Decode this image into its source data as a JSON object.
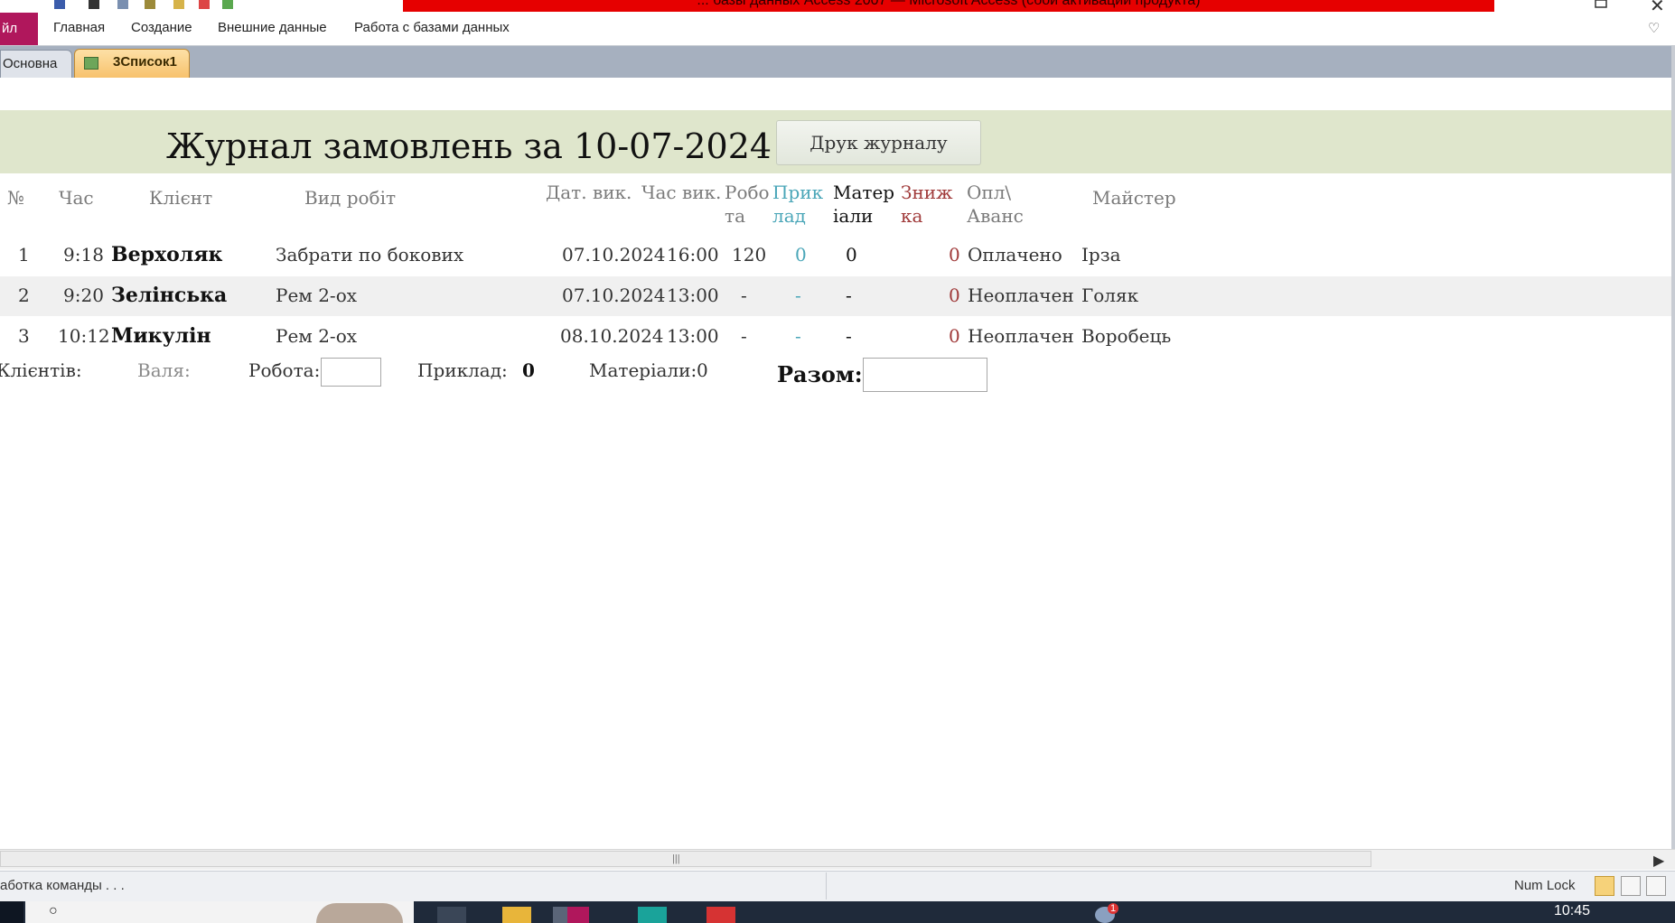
{
  "window": {
    "title": "... базы данных Access 2007 — Microsoft Access (сбой активации продукта)"
  },
  "ribbon": {
    "file_tab": "йл",
    "tabs": [
      "Главная",
      "Создание",
      "Внешние данные",
      "Работа с базами данных"
    ]
  },
  "doc_tabs": [
    "Основна",
    "3Список1"
  ],
  "form": {
    "title": "Журнал замовлень за  10-07-2024",
    "print_button": "Друк журналу",
    "headers": {
      "num": "№",
      "time": "Час",
      "client": "Клієнт",
      "work_type": "Вид робіт",
      "due_date": "Дат. вик.",
      "due_time": "Час вик.",
      "work_a": "Робо",
      "work_b": "та",
      "tool_a": "Прик",
      "tool_b": "лад",
      "mat_a": "Матер",
      "mat_b": "іали",
      "disc_a": "Зниж",
      "disc_b": "ка",
      "pay_a": "Опл\\",
      "pay_b": "Аванс",
      "master": "Майстер"
    },
    "rows": [
      {
        "num": "1",
        "time": "9:18",
        "client": "Верхоляк",
        "work": "Забрати по бокових",
        "date": "07.10.2024",
        "due": "16:00",
        "labor": "120",
        "tool": "0",
        "materials": "0",
        "discount": "0",
        "payment": "Оплачено",
        "master": "Ірза"
      },
      {
        "num": "2",
        "time": "9:20",
        "client": "Зелінська",
        "work": "Рем 2-ох",
        "date": "07.10.2024",
        "due": "13:00",
        "labor": "-",
        "tool": "-",
        "materials": "-",
        "discount": "0",
        "payment": "Неоплачен",
        "master": "Голяк"
      },
      {
        "num": "3",
        "time": "10:12",
        "client": "Микулін",
        "work": "Рем 2-ох",
        "date": "08.10.2024",
        "due": "13:00",
        "labor": "-",
        "tool": "-",
        "materials": "-",
        "discount": "0",
        "payment": "Неоплачен",
        "master": "Воробець"
      }
    ],
    "footer": {
      "clients_label": "Клієнтів:",
      "valya_label": "Валя:",
      "work_label": "Робота:",
      "tool_label": "Приклад:",
      "tool_value": "0",
      "materials_label": "Матеріали:",
      "materials_value": "0",
      "total_label": "Разом:"
    }
  },
  "status": {
    "text": "аботка команды . . .",
    "numlock": "Num Lock"
  },
  "taskbar": {
    "clock": "10:45",
    "badge": "1"
  },
  "colors": {
    "file_tab": "#b0175c",
    "title_bar": "#e60000",
    "header_band": "#dfe6cc",
    "tool_teal": "#4aa6b8",
    "discount_red": "#a03a3a"
  }
}
